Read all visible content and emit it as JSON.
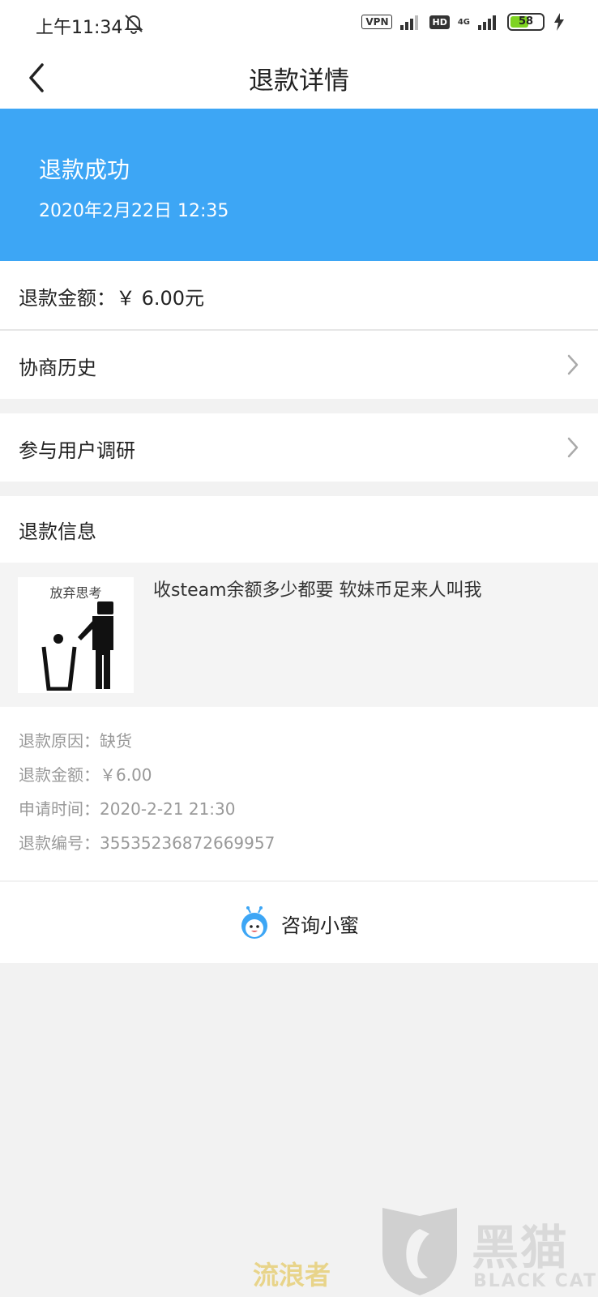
{
  "status_bar": {
    "time": "上午11:34",
    "vpn": "VPN",
    "hd": "HD",
    "network": "4G",
    "battery": "58",
    "battery_level": 0.58
  },
  "nav": {
    "title": "退款详情"
  },
  "banner": {
    "status": "退款成功",
    "time": "2020年2月22日 12:35",
    "color": "#3da6f5"
  },
  "summary": {
    "amount_label": "退款金额：￥ 6.00元"
  },
  "menu": {
    "history": "协商历史",
    "survey": "参与用户调研"
  },
  "info": {
    "header": "退款信息",
    "product": {
      "thumb_caption": "放弃思考",
      "title": "收steam余额多少都要 软妹币足来人叫我"
    },
    "reason": "退款原因：缺货",
    "amount": "退款金额：￥6.00",
    "apply_time": "申请时间：2020-2-21 21:30",
    "refund_no": "退款编号：3553523687266995​7"
  },
  "consult": {
    "label": "咨询小蜜"
  },
  "watermark": {
    "wanderer": "流浪者",
    "brand_cn": "黑猫",
    "brand_en": "BLACK CAT"
  }
}
